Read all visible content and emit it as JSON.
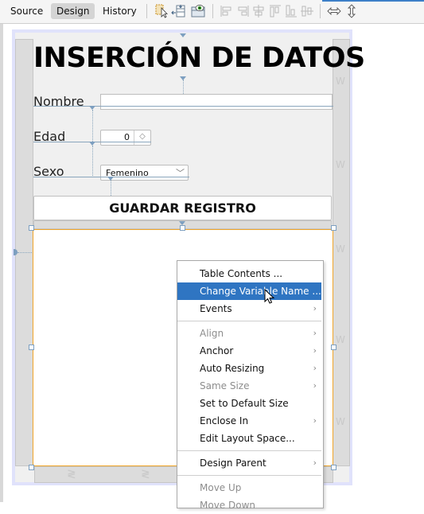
{
  "toolbar": {
    "tabs": [
      {
        "label": "Source",
        "active": false
      },
      {
        "label": "Design",
        "active": true
      },
      {
        "label": "History",
        "active": false
      }
    ],
    "icons": [
      "selection-mode-icon",
      "connection-mode-icon",
      "preview-design-icon",
      "align-left-icon",
      "align-right-icon",
      "center-horizontally-icon",
      "align-top-icon",
      "align-bottom-icon",
      "center-vertically-icon",
      "resize-horizontal-icon",
      "resize-vertical-icon"
    ],
    "accent_color": "#3d7fc8"
  },
  "form": {
    "title": "INSERCIÓN DE DATOS",
    "fields": {
      "nombre_label": "Nombre",
      "nombre_value": "",
      "edad_label": "Edad",
      "edad_value": "0",
      "sexo_label": "Sexo",
      "sexo_value": "Femenino"
    },
    "button_label": "GUARDAR REGISTRO",
    "selection_color": "#f0a52a"
  },
  "context_menu": {
    "items": [
      {
        "label": "Table Contents ...",
        "enabled": true,
        "submenu": false,
        "selected": false
      },
      {
        "label": "Change Variable Name ...",
        "enabled": true,
        "submenu": false,
        "selected": true
      },
      {
        "label": "Events",
        "enabled": true,
        "submenu": true,
        "selected": false
      },
      {
        "separator": true
      },
      {
        "label": "Align",
        "enabled": false,
        "submenu": true,
        "selected": false
      },
      {
        "label": "Anchor",
        "enabled": true,
        "submenu": true,
        "selected": false
      },
      {
        "label": "Auto Resizing",
        "enabled": true,
        "submenu": true,
        "selected": false
      },
      {
        "label": "Same Size",
        "enabled": false,
        "submenu": true,
        "selected": false
      },
      {
        "label": "Set to Default Size",
        "enabled": true,
        "submenu": false,
        "selected": false
      },
      {
        "label": "Enclose In",
        "enabled": true,
        "submenu": true,
        "selected": false
      },
      {
        "label": "Edit Layout Space...",
        "enabled": true,
        "submenu": false,
        "selected": false
      },
      {
        "separator": true
      },
      {
        "label": "Design Parent",
        "enabled": true,
        "submenu": true,
        "selected": false
      },
      {
        "separator": true
      },
      {
        "label": "Move Up",
        "enabled": false,
        "submenu": false,
        "selected": false
      },
      {
        "label": "Move Down",
        "enabled": false,
        "submenu": false,
        "selected": false
      }
    ],
    "highlight_color": "#2f75c2",
    "submenu_arrow": "›"
  },
  "glyphs": {
    "spinner": "◇",
    "combo_arrow": "﹀",
    "zigzag_v": "W",
    "zigzag_h": "≷"
  }
}
